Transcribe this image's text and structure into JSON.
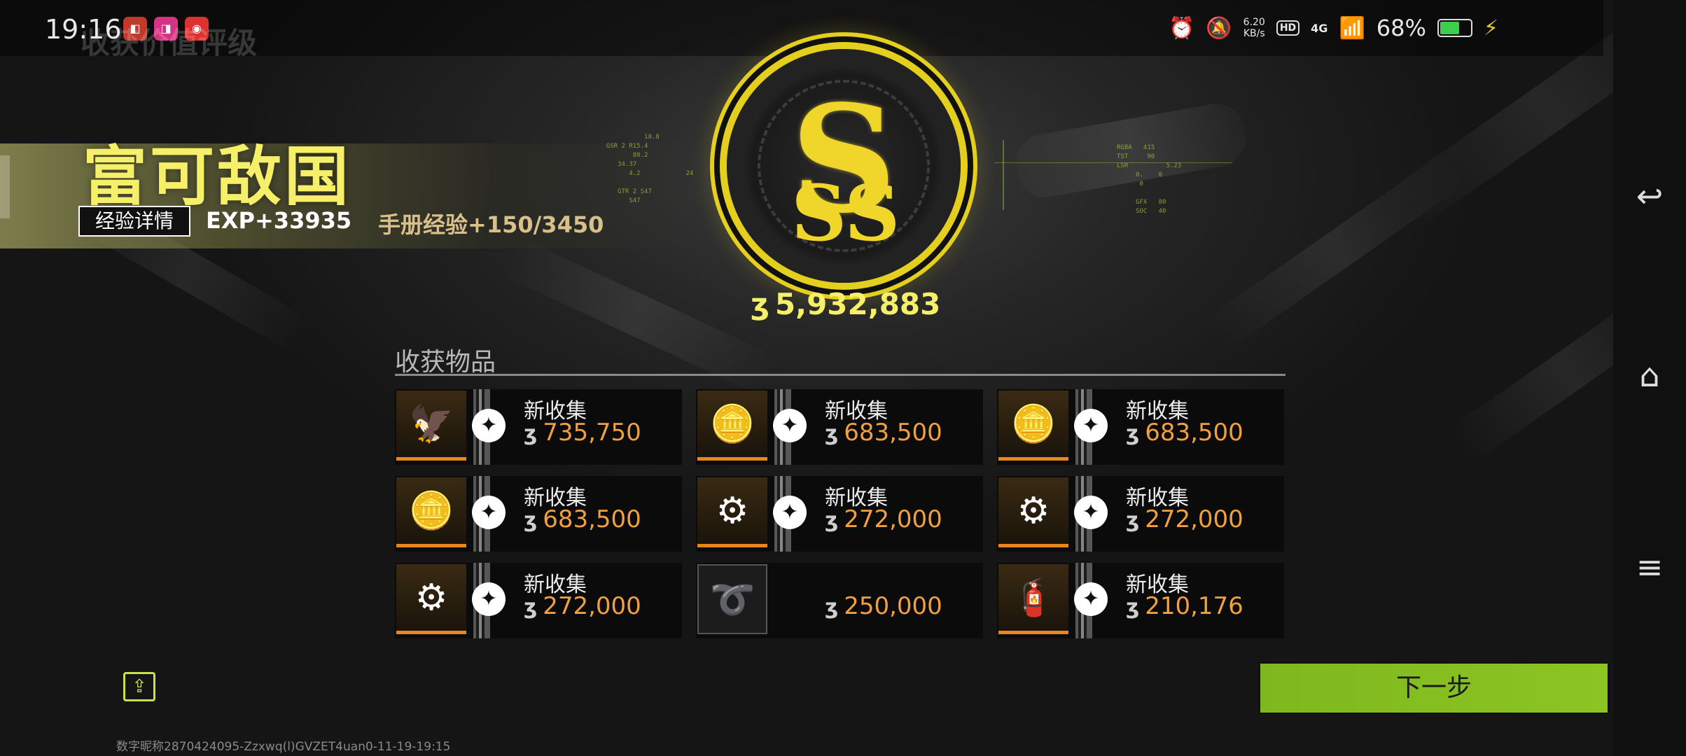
{
  "status_bar": {
    "time": "19:16",
    "net_speed_value": "6.20",
    "net_speed_unit": "KB/s",
    "hd": "HD",
    "network": "4G",
    "battery": "68%",
    "battery_level": 0.68
  },
  "ghost_title": "收获价值评级",
  "rating": {
    "title": "富可敌国",
    "exp_details_label": "经验详情",
    "exp": "EXP+33935",
    "handbook_exp": "手册经验+150/3450",
    "medal_letter": "S",
    "total_value": "5,932,883",
    "currency_symbol": "ʒ"
  },
  "loot": {
    "title": "收获物品",
    "items": [
      {
        "label": "新收集",
        "price": "735,750",
        "icon": "golden-eagle-statue-icon",
        "glyph": "🦅",
        "new": true
      },
      {
        "label": "新收集",
        "price": "683,500",
        "icon": "gold-coin-icon",
        "glyph": "🪙",
        "new": true
      },
      {
        "label": "新收集",
        "price": "683,500",
        "icon": "gold-coin-icon",
        "glyph": "🪙",
        "new": true
      },
      {
        "label": "新收集",
        "price": "683,500",
        "icon": "gold-coin-icon",
        "glyph": "🪙",
        "new": true
      },
      {
        "label": "新收集",
        "price": "272,000",
        "icon": "drone-device-icon",
        "glyph": "⚙",
        "new": true
      },
      {
        "label": "新收集",
        "price": "272,000",
        "icon": "drone-device-icon",
        "glyph": "⚙",
        "new": true
      },
      {
        "label": "新收集",
        "price": "272,000",
        "icon": "drone-device-icon",
        "glyph": "⚙",
        "new": true
      },
      {
        "label": "",
        "price": "250,000",
        "icon": "red-cable-icon",
        "glyph": "➰",
        "new": false
      },
      {
        "label": "新收集",
        "price": "210,176",
        "icon": "canister-icon",
        "glyph": "🧯",
        "new": true
      }
    ]
  },
  "next_label": "下一步",
  "watermark": "数字昵称2870424095-Zzxwq(l)GVZET4uan0-11-19-19:15",
  "colors": {
    "accent_yellow": "#f6ef6a",
    "price_orange": "#f0a040",
    "next_green": "#8cc423",
    "tile_border_orange": "#e7861f"
  }
}
